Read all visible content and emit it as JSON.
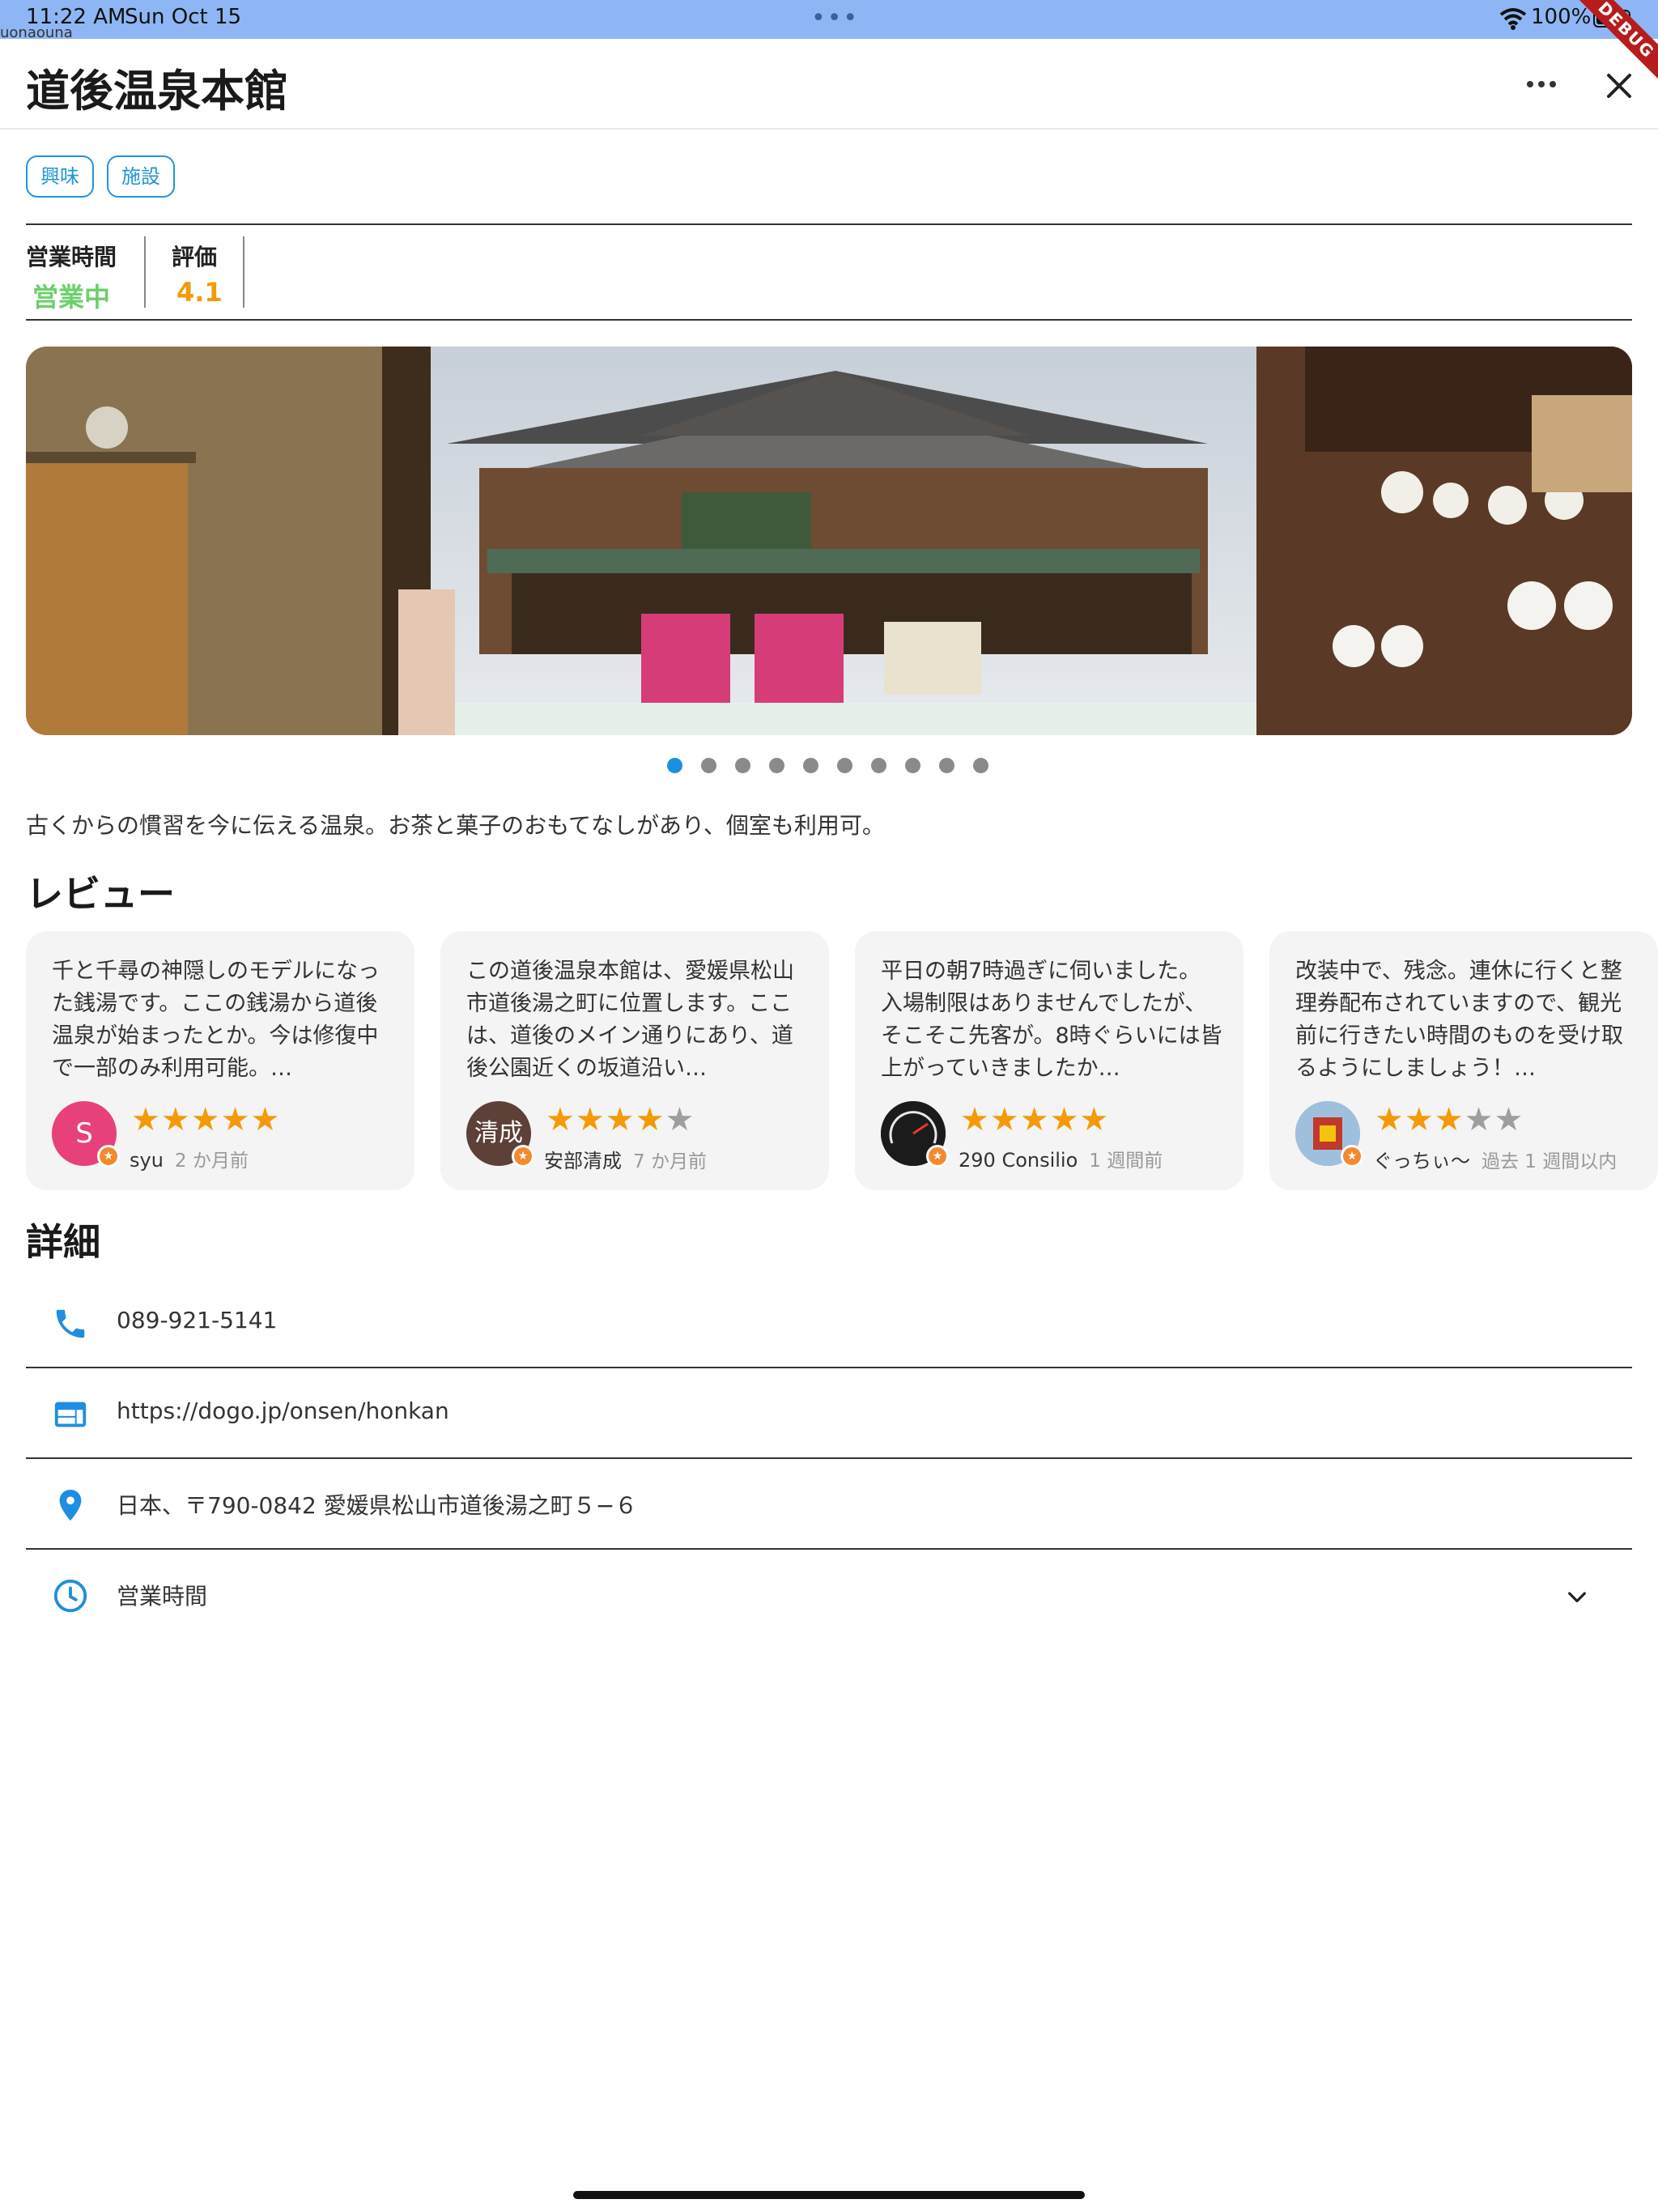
{
  "status_bar": {
    "time": "11:22 AM",
    "date": "Sun Oct 15",
    "battery": "100%",
    "overflow_text": "uonaouna",
    "debug_label": "DEBUG"
  },
  "header": {
    "title": "道後温泉本館"
  },
  "chips": [
    "興味",
    "施設"
  ],
  "info": {
    "hours_label": "営業時間",
    "hours_value": "営業中",
    "hours_color": "#6cd06a",
    "rating_label": "評価",
    "rating_value": "4.1",
    "rating_color": "#f59a07"
  },
  "carousel": {
    "image_count": 10,
    "active_index": 0
  },
  "description": "古くからの慣習を今に伝える温泉。お茶と菓子のおもてなしがあり、個室も利用可。",
  "reviews_heading": "レビュー",
  "reviews": [
    {
      "text": "千と千尋の神隠しのモデルになった銭湯です。ここの銭湯から道後温泉が始まったとか。今は修復中で一部のみ利用可能。…",
      "avatar_initial": "S",
      "avatar_color": "#e8407a",
      "rating": 5,
      "author": "syu",
      "time": "2 か月前"
    },
    {
      "text": "この道後温泉本館は、愛媛県松山市道後湯之町に位置します。ここは、道後のメイン通りにあり、道後公園近くの坂道沿い…",
      "avatar_initial": "清成",
      "avatar_color": "#5d4037",
      "rating": 4,
      "author": "安部清成",
      "time": "7 か月前"
    },
    {
      "text": "平日の朝7時過ぎに伺いました。入場制限はありませんでしたが、そこそこ先客が。8時ぐらいには皆上がっていきましたか…",
      "avatar_initial": "",
      "avatar_color": "#1b1b1b",
      "rating": 5,
      "author": "290 Consilio",
      "time": "1 週間前"
    },
    {
      "text": "改装中で、残念。連休に行くと整理券配布されていますので、観光前に行きたい時間のものを受け取るようにしましょう！…",
      "avatar_initial": "",
      "avatar_color": "#7fa6c9",
      "rating": 3,
      "author": "ぐっちぃ〜",
      "time": "過去 1 週間以内"
    }
  ],
  "details_heading": "詳細",
  "details": {
    "phone": "089-921-5141",
    "website": "https://dogo.jp/onsen/honkan",
    "address": "日本、〒790-0842 愛媛県松山市道後湯之町５−６",
    "hours": "営業時間"
  },
  "colors": {
    "accent": "#1e8fe0",
    "star": "#f59a07",
    "status_bar": "#8fb6f4"
  }
}
